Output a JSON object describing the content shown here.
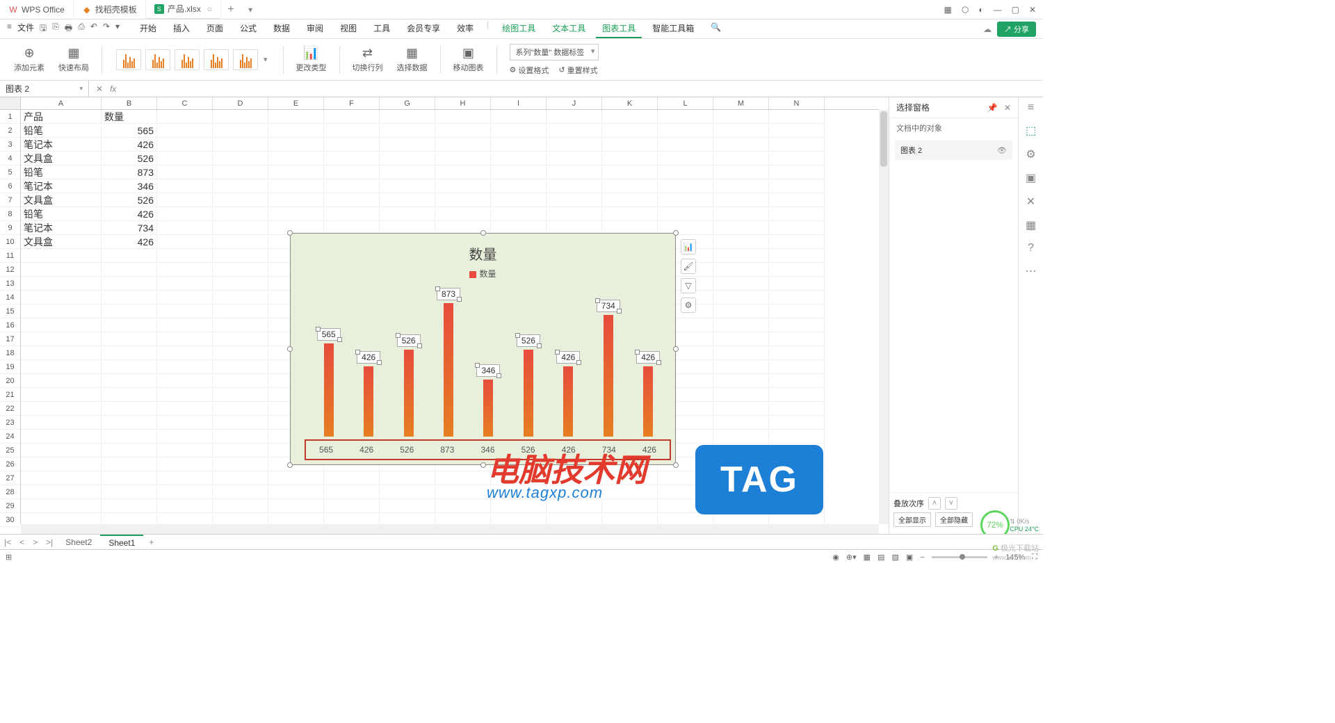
{
  "tabs": [
    {
      "icon": "W",
      "label": "WPS Office"
    },
    {
      "icon": "●",
      "label": "找稻壳模板"
    },
    {
      "icon": "S",
      "label": "产品.xlsx"
    }
  ],
  "menu": {
    "file": "文件",
    "items": [
      "开始",
      "插入",
      "页面",
      "公式",
      "数据",
      "审阅",
      "视图",
      "工具",
      "会员专享",
      "效率"
    ],
    "green_items": [
      "绘图工具",
      "文本工具",
      "图表工具",
      "智能工具箱"
    ],
    "active": "图表工具"
  },
  "ribbon": {
    "add_element": "添加元素",
    "quick_layout": "快速布局",
    "change_type": "更改类型",
    "switch_rc": "切换行列",
    "select_data": "选择数据",
    "move_chart": "移动图表",
    "series_dropdown": "系列\"数量\" 数据标签",
    "set_format": "设置格式",
    "reset_style": "重置样式"
  },
  "share": "分享",
  "namebox": "图表 2",
  "panel": {
    "title": "选择窗格",
    "sub": "文档中的对象",
    "item": "图表 2",
    "stack": "叠放次序",
    "show_all": "全部显示",
    "hide_all": "全部隐藏"
  },
  "columns": [
    "A",
    "B",
    "C",
    "D",
    "E",
    "F",
    "G",
    "H",
    "I",
    "J",
    "K",
    "L",
    "M",
    "N"
  ],
  "table": {
    "h1": "产品",
    "h2": "数量",
    "rows": [
      [
        "铅笔",
        565
      ],
      [
        "笔记本",
        426
      ],
      [
        "文具盒",
        526
      ],
      [
        "铅笔",
        873
      ],
      [
        "笔记本",
        346
      ],
      [
        "文具盒",
        526
      ],
      [
        "铅笔",
        426
      ],
      [
        "笔记本",
        734
      ],
      [
        "文具盒",
        426
      ]
    ]
  },
  "chart_data": {
    "type": "bar",
    "title": "数量",
    "legend": "数量",
    "categories": [
      "565",
      "426",
      "526",
      "873",
      "346",
      "526",
      "426",
      "734",
      "426"
    ],
    "values": [
      565,
      426,
      526,
      873,
      346,
      526,
      426,
      734,
      426
    ],
    "ylabel": "",
    "xlabel": "",
    "ylim": [
      0,
      900
    ]
  },
  "sheets": {
    "s1": "Sheet2",
    "s2": "Sheet1"
  },
  "status": {
    "zoom": "145%",
    "perf": "72%",
    "net": "0K/s",
    "cpu": "CPU 24°C"
  },
  "watermark": {
    "t1": "电脑技术网",
    "t2": "www.tagxp.com",
    "t3": "TAG",
    "t4": "极光下载站",
    "t5": "www.xz7.com"
  }
}
